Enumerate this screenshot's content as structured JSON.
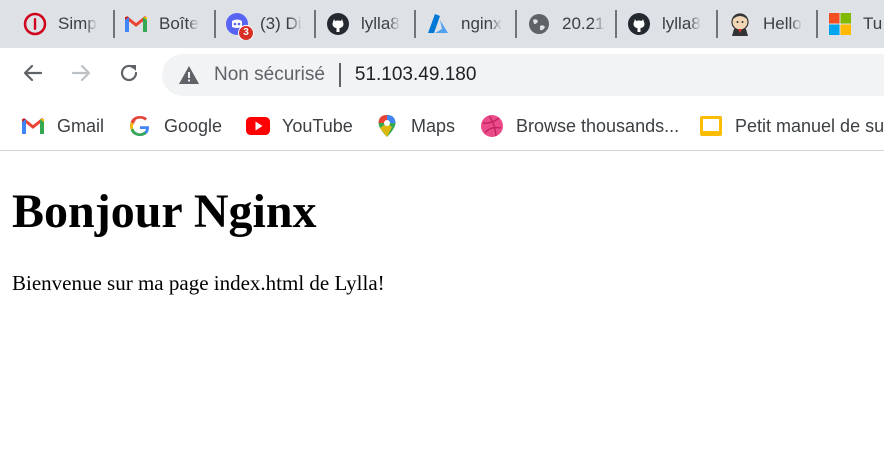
{
  "tabs": [
    {
      "title": "Simp",
      "icon": "opera-red-icon"
    },
    {
      "title": "Boîte",
      "icon": "gmail-icon"
    },
    {
      "title": "(3) Di",
      "icon": "discord-icon",
      "badge": "3"
    },
    {
      "title": "lylla8",
      "icon": "github-icon"
    },
    {
      "title": "nginx",
      "icon": "azure-icon"
    },
    {
      "title": "20.21",
      "icon": "globe-icon"
    },
    {
      "title": "lylla8",
      "icon": "github-icon"
    },
    {
      "title": "Hello",
      "icon": "jenkins-icon"
    },
    {
      "title": "Tu",
      "icon": "microsoft-icon"
    }
  ],
  "toolbar": {
    "back_label": "Back",
    "forward_label": "Forward",
    "reload_label": "Reload",
    "security_text": "Non sécurisé",
    "url": "51.103.49.180"
  },
  "bookmarks": [
    {
      "label": "Gmail",
      "icon": "gmail-icon"
    },
    {
      "label": "Google",
      "icon": "google-icon"
    },
    {
      "label": "YouTube",
      "icon": "youtube-icon"
    },
    {
      "label": "Maps",
      "icon": "maps-icon"
    },
    {
      "label": "Browse thousands...",
      "icon": "dribbble-icon"
    },
    {
      "label": "Petit manuel de sur",
      "icon": "bookmark-yellow-icon"
    }
  ],
  "page": {
    "heading": "Bonjour Nginx",
    "text": "Bienvenue sur ma page index.html de Lylla!"
  },
  "colors": {
    "tabstrip_bg": "#dee1e6",
    "omnibox_bg": "#f1f3f4",
    "text_dark": "#202124",
    "text_muted": "#5f6368"
  }
}
